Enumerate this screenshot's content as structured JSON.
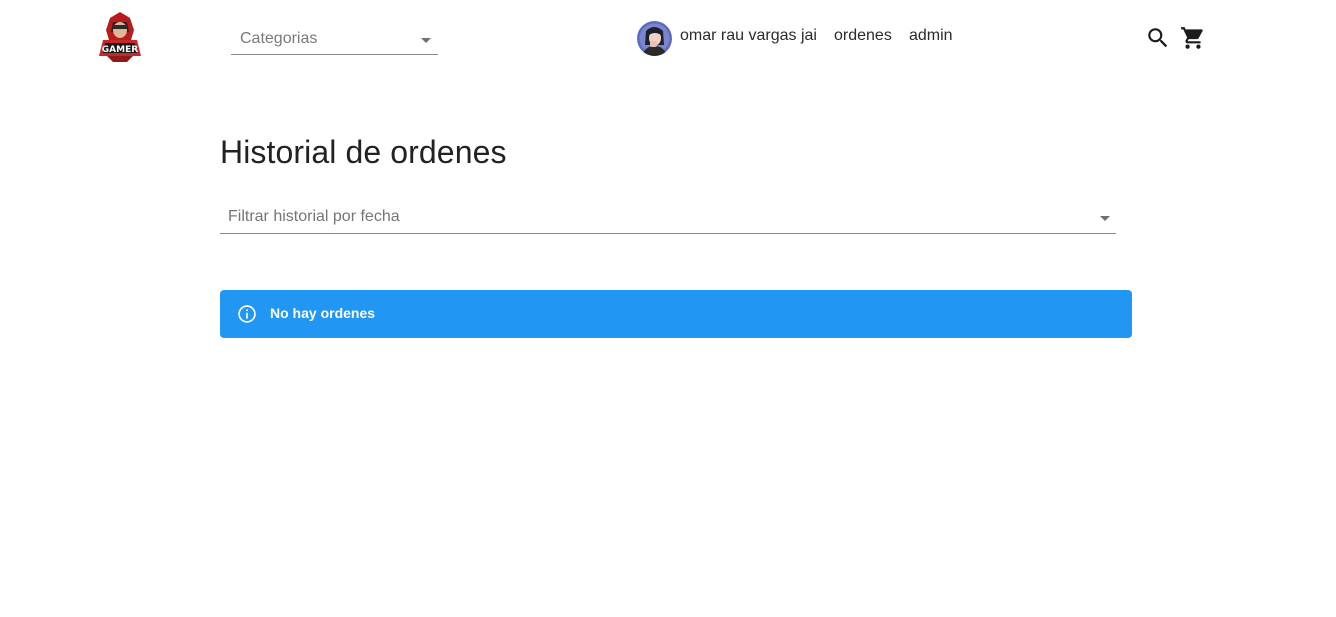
{
  "header": {
    "logo_text": "GAMER",
    "categories_placeholder": "Categorias",
    "user_name": "omar rau vargas jai",
    "nav_orders": "ordenes",
    "nav_admin": "admin",
    "icons": {
      "search": "search-icon",
      "cart": "shopping-cart-icon",
      "categories_caret": "arrow-drop-down-icon"
    }
  },
  "main": {
    "title": "Historial de ordenes",
    "date_filter_placeholder": "Filtrar historial por fecha",
    "alert": {
      "message": "No hay ordenes",
      "icon": "info-icon",
      "color": "#2196f3"
    }
  }
}
